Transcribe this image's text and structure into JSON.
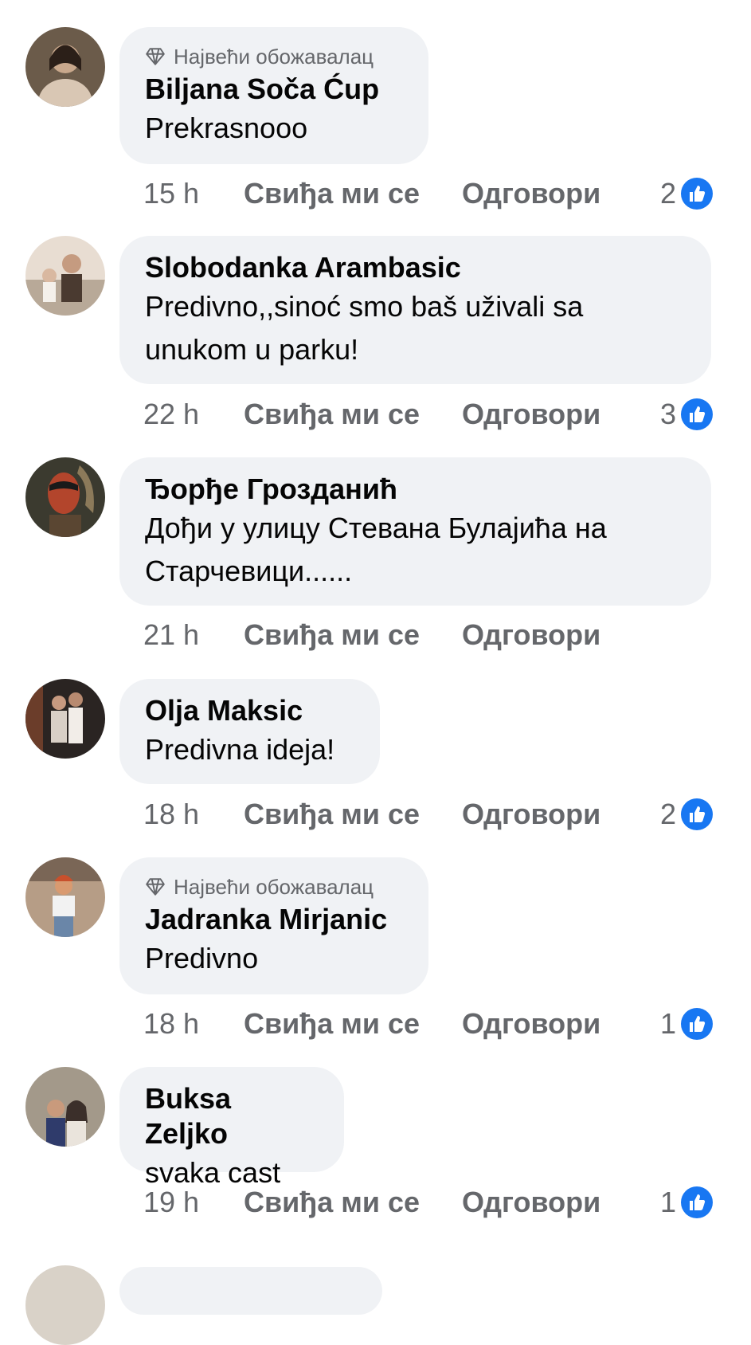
{
  "comments": [
    {
      "badge": "Највећи обожавалац",
      "name": "Biljana Soča Ćup",
      "text": "Prekrasnooo",
      "time": "15 h",
      "like_label": "Свиђа ми се",
      "reply_label": "Одговори",
      "reactions": "2",
      "avatar_colors": [
        "#6b5b4a",
        "#d9c7b4"
      ]
    },
    {
      "name": "Slobodanka Arambasic",
      "text_lines": [
        "Predivno,,sinoć smo baš uživali sa",
        "unukom u parku!"
      ],
      "time": "22 h",
      "like_label": "Свиђа ми се",
      "reply_label": "Одговори",
      "reactions": "3",
      "avatar_colors": [
        "#e8ddd2",
        "#4a3a30"
      ]
    },
    {
      "name": "Ђорђе Грозданић",
      "text_lines": [
        "Дођи у улицу  Стевана Булајића на",
        "Старчевици......"
      ],
      "time": "21 h",
      "like_label": "Свиђа ми се",
      "reply_label": "Одговори",
      "avatar_colors": [
        "#3b3a2f",
        "#b3452c"
      ]
    },
    {
      "name": "Olja Maksic",
      "text": "Predivna ideja!",
      "time": "18 h",
      "like_label": "Свиђа ми се",
      "reply_label": "Одговори",
      "reactions": "2",
      "avatar_colors": [
        "#2a2422",
        "#d8cfc6"
      ]
    },
    {
      "badge": "Највећи обожавалац",
      "name": "Jadranka Mirjanic",
      "text": "Predivno",
      "time": "18 h",
      "like_label": "Свиђа ми се",
      "reply_label": "Одговори",
      "reactions": "1",
      "avatar_colors": [
        "#b69d86",
        "#f2f2f2"
      ]
    },
    {
      "name": "Buksa Zeljko",
      "text": "svaka cast",
      "time": "19 h",
      "like_label": "Свиђа ми се",
      "reply_label": "Одговори",
      "reactions": "1",
      "avatar_colors": [
        "#a3998a",
        "#3b2f2a"
      ]
    }
  ],
  "colors": {
    "bubble": "#f0f2f5",
    "like_blue": "#1877f2",
    "muted": "#65676b"
  }
}
